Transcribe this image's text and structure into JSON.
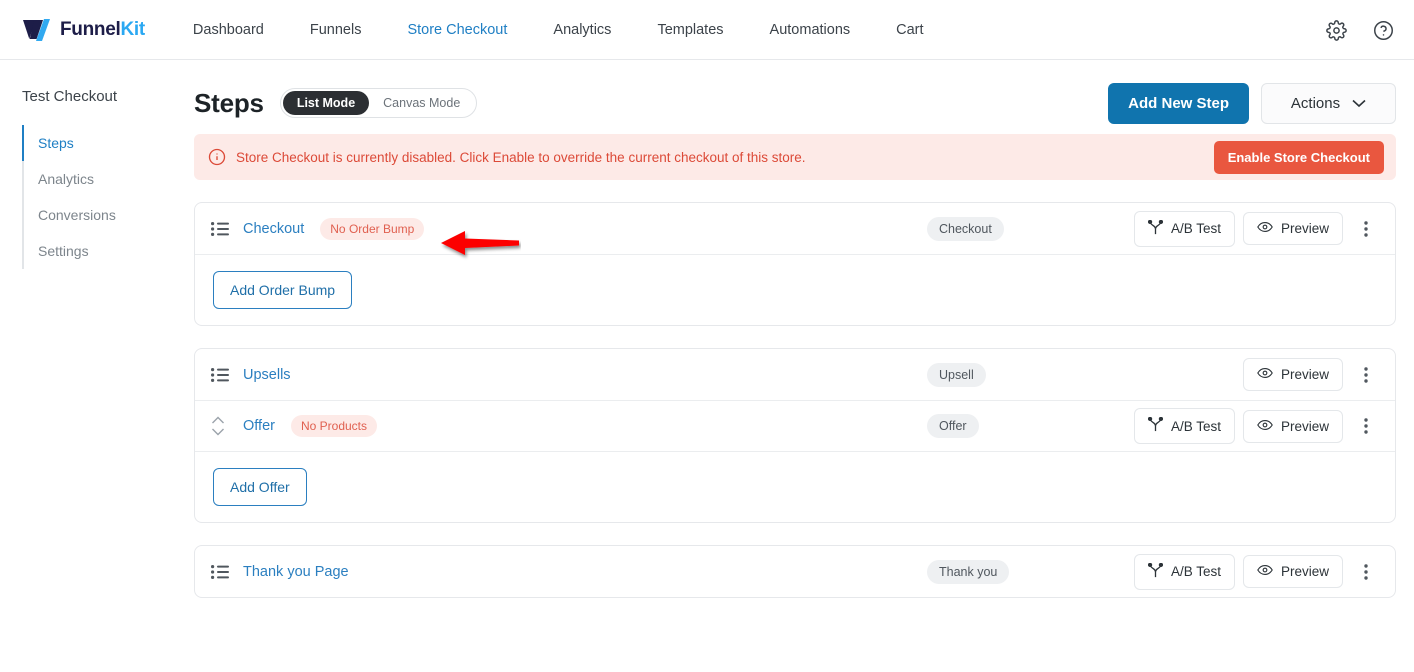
{
  "brand": {
    "name_dark": "Funnel",
    "name_light": "Kit",
    "color_dark": "#1d1d48",
    "color_light": "#2aa8f2"
  },
  "topnav": {
    "items": [
      {
        "label": "Dashboard",
        "active": false
      },
      {
        "label": "Funnels",
        "active": false
      },
      {
        "label": "Store Checkout",
        "active": true
      },
      {
        "label": "Analytics",
        "active": false
      },
      {
        "label": "Templates",
        "active": false
      },
      {
        "label": "Automations",
        "active": false
      },
      {
        "label": "Cart",
        "active": false
      }
    ],
    "settings_icon": "gear-icon",
    "help_icon": "help-circle-icon",
    "active_color": "#1f7fc4"
  },
  "sidebar": {
    "title": "Test Checkout",
    "items": [
      {
        "label": "Steps",
        "active": true
      },
      {
        "label": "Analytics",
        "active": false
      },
      {
        "label": "Conversions",
        "active": false
      },
      {
        "label": "Settings",
        "active": false
      }
    ]
  },
  "header": {
    "title": "Steps",
    "modes": [
      {
        "label": "List Mode",
        "active": true
      },
      {
        "label": "Canvas Mode",
        "active": false
      }
    ],
    "add_step_label": "Add New Step",
    "actions_label": "Actions",
    "actions_icon": "chevron-down-icon",
    "primary_color": "#1074ae"
  },
  "alert": {
    "icon": "info-circle-icon",
    "message": "Store Checkout is currently disabled. Click Enable to override the current checkout of this store.",
    "button_label": "Enable Store Checkout",
    "bg_color": "#fdeae7",
    "text_color": "#dc4a38",
    "button_color": "#e9573f"
  },
  "common": {
    "ab_test_label": "A/B Test",
    "preview_label": "Preview",
    "ab_test_icon": "split-branch-icon",
    "preview_icon": "eye-icon",
    "kebab_icon": "more-vertical-icon",
    "list_icon": "list-icon",
    "sort-icon": "sort-updown-icon"
  },
  "cards": [
    {
      "rows": [
        {
          "icon": "list-icon",
          "name": "Checkout",
          "warn_badge": "No Order Bump",
          "type_badge": "Checkout",
          "has_ab_test": true,
          "has_preview": true,
          "has_kebab": true
        }
      ],
      "footer_button": "Add Order Bump"
    },
    {
      "rows": [
        {
          "icon": "list-icon",
          "name": "Upsells",
          "warn_badge": "",
          "type_badge": "Upsell",
          "has_ab_test": false,
          "has_preview": true,
          "has_kebab": true
        },
        {
          "icon": "sort-updown-icon",
          "name": "Offer",
          "warn_badge": "No Products",
          "type_badge": "Offer",
          "has_ab_test": true,
          "has_preview": true,
          "has_kebab": true
        }
      ],
      "footer_button": "Add Offer"
    },
    {
      "rows": [
        {
          "icon": "list-icon",
          "name": "Thank you Page",
          "warn_badge": "",
          "type_badge": "Thank you",
          "has_ab_test": true,
          "has_preview": true,
          "has_kebab": true
        }
      ],
      "footer_button": ""
    }
  ],
  "annotation": {
    "type": "arrow-left",
    "color": "#fc0000",
    "points_to": "No Order Bump"
  }
}
